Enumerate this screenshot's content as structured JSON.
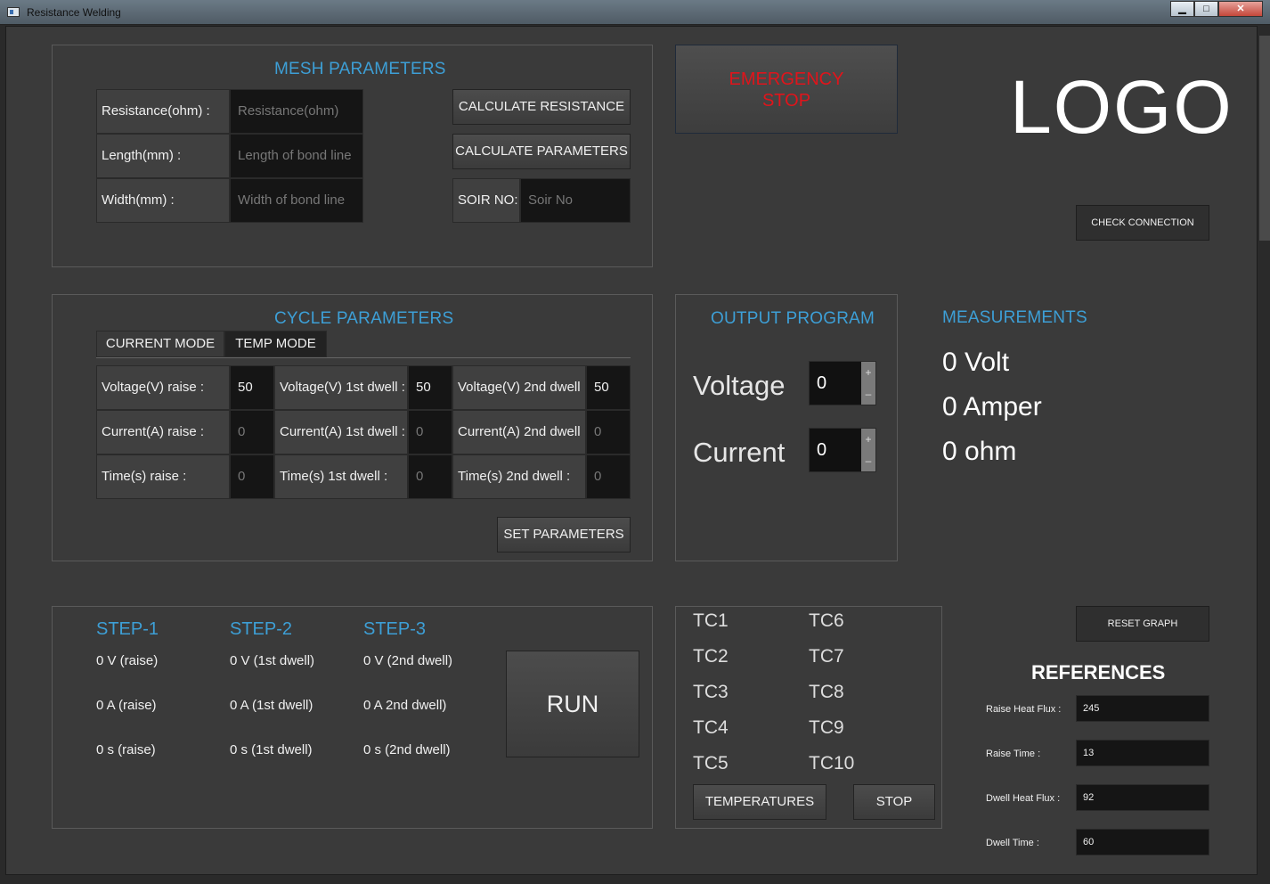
{
  "window": {
    "title": "Resistance Welding",
    "minimize": "▁",
    "maximize": "□",
    "close": "✕"
  },
  "mesh": {
    "title": "MESH PARAMETERS",
    "rows": [
      {
        "label": "Resistance(ohm) :",
        "placeholder": "Resistance(ohm)"
      },
      {
        "label": "Length(mm) :",
        "placeholder": "Length of bond line"
      },
      {
        "label": "Width(mm) :",
        "placeholder": "Width of bond line"
      }
    ],
    "calc_resistance": "CALCULATE RESISTANCE",
    "calc_parameters": "CALCULATE PARAMETERS",
    "soir_label": "SOIR NO:",
    "soir_placeholder": "Soir No"
  },
  "emergency": {
    "label_line1": "EMERGENCY",
    "label_line2": "STOP",
    "color": "#e0141b"
  },
  "logo": "LOGO",
  "check_connection": "CHECK CONNECTION",
  "cycle": {
    "title": "CYCLE PARAMETERS",
    "tabs": [
      "CURRENT MODE",
      "TEMP MODE"
    ],
    "rows": [
      [
        {
          "label": "Voltage(V) raise :",
          "value": "50"
        },
        {
          "label": "Voltage(V) 1st dwell :",
          "value": "50"
        },
        {
          "label": "Voltage(V) 2nd dwell :",
          "value": "50"
        }
      ],
      [
        {
          "label": "Current(A) raise :",
          "value": "0"
        },
        {
          "label": "Current(A) 1st dwell :",
          "value": "0"
        },
        {
          "label": "Current(A) 2nd dwell :",
          "value": "0"
        }
      ],
      [
        {
          "label": "Time(s) raise :",
          "value": "0"
        },
        {
          "label": "Time(s) 1st dwell :",
          "value": "0"
        },
        {
          "label": "Time(s) 2nd dwell :",
          "value": "0"
        }
      ]
    ],
    "set_parameters": "SET PARAMETERS"
  },
  "output": {
    "title": "OUTPUT PROGRAM",
    "voltage_label": "Voltage",
    "voltage_value": "0",
    "current_label": "Current",
    "current_value": "0",
    "plus": "+",
    "minus": "–"
  },
  "measurements": {
    "title": "MEASUREMENTS",
    "volt": "0 Volt",
    "amper": "0 Amper",
    "ohm": "0 ohm"
  },
  "steps": [
    {
      "title": "STEP-1",
      "v": "0 V (raise)",
      "a": "0 A (raise)",
      "s": "0 s (raise)"
    },
    {
      "title": "STEP-2",
      "v": "0 V (1st dwell)",
      "a": "0 A (1st dwell)",
      "s": "0 s (1st dwell)"
    },
    {
      "title": "STEP-3",
      "v": "0 V (2nd dwell)",
      "a": "0 A 2nd dwell)",
      "s": "0 s (2nd dwell)"
    }
  ],
  "run": "RUN",
  "tc": {
    "left": [
      "TC1",
      "TC2",
      "TC3",
      "TC4",
      "TC5"
    ],
    "right": [
      "TC6",
      "TC7",
      "TC8",
      "TC9",
      "TC10"
    ],
    "temperatures": "TEMPERATURES",
    "stop": "STOP"
  },
  "reset_graph": "RESET GRAPH",
  "references": {
    "title": "REFERENCES",
    "items": [
      {
        "label": "Raise Heat Flux :",
        "value": "245"
      },
      {
        "label": "Raise Time :",
        "value": "13"
      },
      {
        "label": "Dwell Heat Flux :",
        "value": "92"
      },
      {
        "label": "Dwell Time :",
        "value": "60"
      }
    ]
  }
}
